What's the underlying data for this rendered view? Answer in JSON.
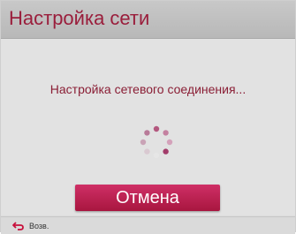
{
  "dialog": {
    "title": "Настройка сети",
    "message": "Настройка сетевого соединения...",
    "cancel_label": "Отмена"
  },
  "footer": {
    "back_label": "Возв.",
    "back_icon": "return-arrow-icon"
  },
  "colors": {
    "accent": "#c0244f",
    "title_text": "#9a1e3c",
    "message_text": "#8a1e35",
    "back_icon": "#c8103c"
  }
}
